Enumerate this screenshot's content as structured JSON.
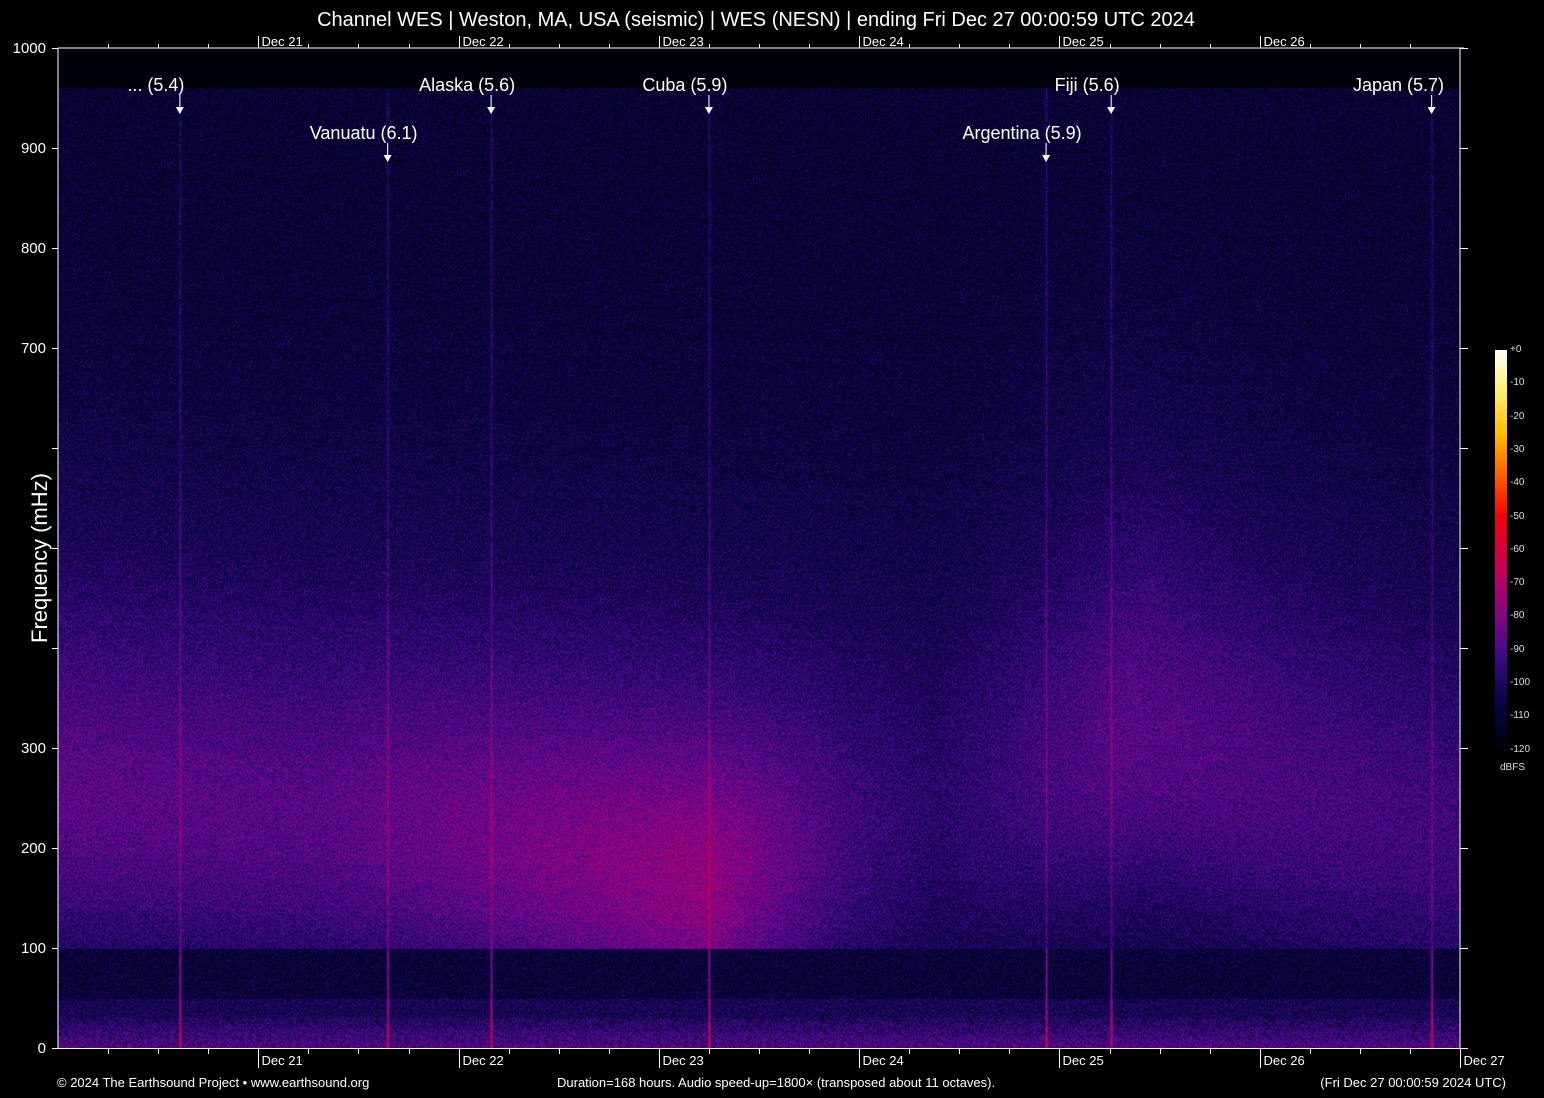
{
  "title": "Channel WES | Weston, MA, USA (seismic) | WES (NESN) | ending Fri Dec 27 00:00:59 UTC 2024",
  "footer": {
    "left": "© 2024 The Earthsound Project • www.earthsound.org",
    "center": "Duration=168 hours. Audio speed-up=1800× (transposed about 11 octaves).",
    "right": "(Fri Dec 27 00:00:59 2024 UTC)"
  },
  "chart_data": {
    "type": "heatmap",
    "title": "Channel WES | Weston, MA, USA (seismic) | WES (NESN) | ending Fri Dec 27 00:00:59 UTC 2024",
    "xlabel": "",
    "ylabel": "Frequency (mHz)",
    "xlim_hours": [
      0,
      168
    ],
    "ylim": [
      0,
      1000
    ],
    "y_ticks": [
      0,
      100,
      200,
      300,
      400,
      500,
      600,
      700,
      800,
      900,
      1000
    ],
    "y_tick_labels": [
      "0",
      "100",
      "200",
      "300",
      "",
      "",
      "",
      "700",
      "800",
      "900",
      "1000"
    ],
    "x_ticks_hours": [
      24,
      48,
      72,
      96,
      120,
      144,
      168
    ],
    "x_tick_labels_top": [
      "Dec 21",
      "Dec 22",
      "Dec 23",
      "Dec 24",
      "Dec 25",
      "Dec 26"
    ],
    "x_tick_labels_bottom": [
      "Dec 21",
      "Dec 22",
      "Dec 23",
      "Dec 24",
      "Dec 25",
      "Dec 26",
      "Dec 27"
    ],
    "minor_tick_interval_hours": 6,
    "colorbar": {
      "label": "dBFS",
      "range": [
        -120,
        0
      ],
      "ticks": [
        "+0",
        "-10",
        "-20",
        "-30",
        "-40",
        "-50",
        "-60",
        "-70",
        "-80",
        "-90",
        "-100",
        "-110",
        "-120"
      ]
    },
    "events": [
      {
        "label": "... (5.4)",
        "hour": 14.6
      },
      {
        "label": "Vanuatu (6.1)",
        "hour": 39.5
      },
      {
        "label": "Alaska (5.6)",
        "hour": 51.9
      },
      {
        "label": "Cuba (5.9)",
        "hour": 78.0
      },
      {
        "label": "Argentina (5.9)",
        "hour": 118.4
      },
      {
        "label": "Fiji (5.6)",
        "hour": 126.2
      },
      {
        "label": "Japan (5.7)",
        "hour": 164.6
      }
    ],
    "peak_microseism": {
      "hour": 78,
      "frequency_mHz": 170,
      "level_dBFS": -70
    }
  }
}
